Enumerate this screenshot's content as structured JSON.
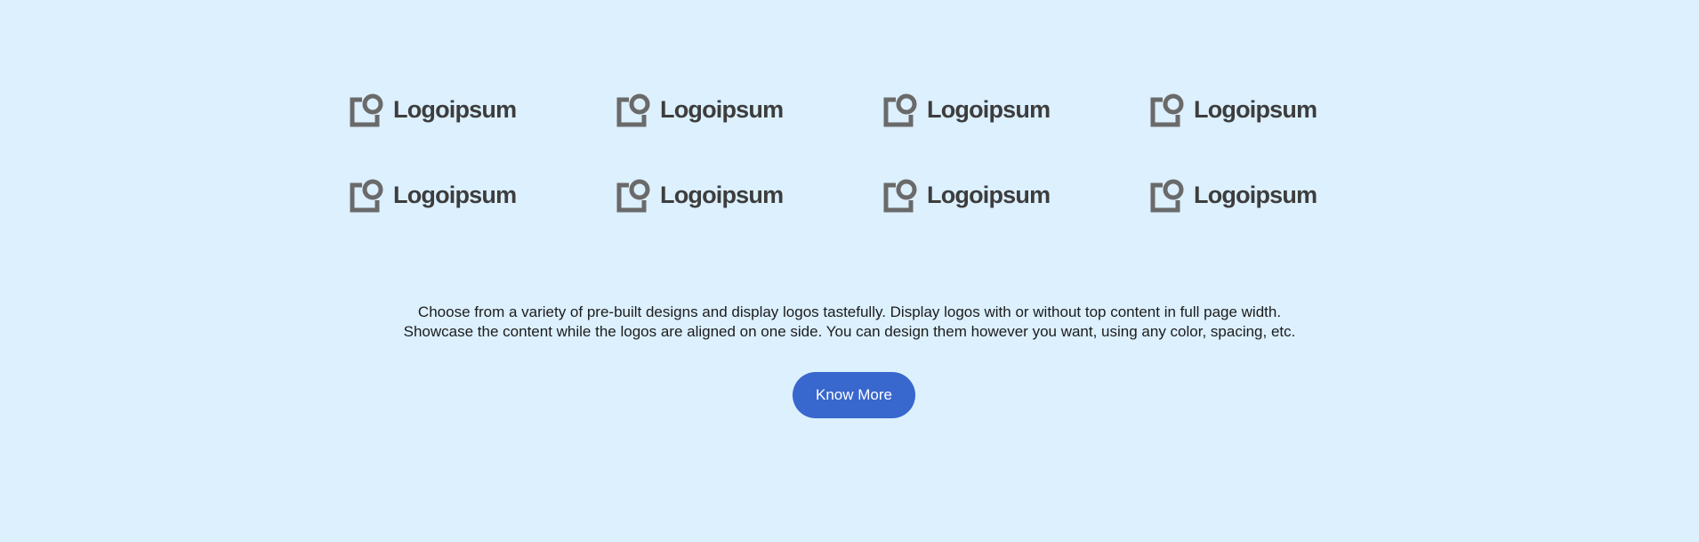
{
  "colors": {
    "background": "#dcf0fe",
    "logo_icon": "#6a6a6a",
    "logo_text": "#3d3d3d",
    "body_text": "#1c1c1c",
    "button_bg": "#3867cd",
    "button_text": "#ffffff"
  },
  "logos": [
    {
      "text": "Logoipsum",
      "icon": "logoipsum-icon"
    },
    {
      "text": "Logoipsum",
      "icon": "logoipsum-icon"
    },
    {
      "text": "Logoipsum",
      "icon": "logoipsum-icon"
    },
    {
      "text": "Logoipsum",
      "icon": "logoipsum-icon"
    },
    {
      "text": "Logoipsum",
      "icon": "logoipsum-icon"
    },
    {
      "text": "Logoipsum",
      "icon": "logoipsum-icon"
    },
    {
      "text": "Logoipsum",
      "icon": "logoipsum-icon"
    },
    {
      "text": "Logoipsum",
      "icon": "logoipsum-icon"
    }
  ],
  "description": {
    "line1": "Choose from a variety of pre-built designs and display logos tastefully. Display logos with or without top content in full page width.",
    "line2": "Showcase the content while the logos are aligned on one side. You can design them however you want, using any color, spacing, etc."
  },
  "cta": {
    "label": "Know More"
  }
}
